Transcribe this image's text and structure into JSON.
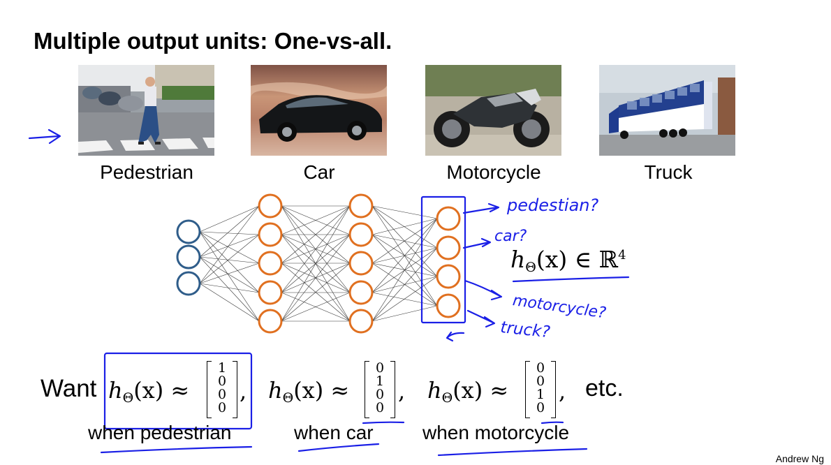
{
  "title": "Multiple output units: One-vs-all.",
  "images": [
    {
      "caption": "Pedestrian",
      "icon": "pedestrian-photo"
    },
    {
      "caption": "Car",
      "icon": "car-photo"
    },
    {
      "caption": "Motorcycle",
      "icon": "motorcycle-photo"
    },
    {
      "caption": "Truck",
      "icon": "truck-photo"
    }
  ],
  "network": {
    "layer_sizes": [
      3,
      5,
      5,
      4
    ],
    "input_color": "#2f5d8a",
    "hidden_color": "#e07020"
  },
  "hypothesis": {
    "h": "h",
    "theta": "Θ",
    "arg": "(x)",
    "rest": "∈ ℝ",
    "power": "4"
  },
  "handwritten": {
    "labels": [
      "pedestian?",
      "car?",
      "motorcycle?",
      "truck?"
    ],
    "ink_color": "#1a1fe6"
  },
  "bottom": {
    "want": "Want",
    "approx": "≈",
    "vectors": [
      [
        "1",
        "0",
        "0",
        "0"
      ],
      [
        "0",
        "1",
        "0",
        "0"
      ],
      [
        "0",
        "0",
        "1",
        "0"
      ]
    ],
    "comma": ",",
    "etc": "etc.",
    "whens": [
      "when pedestrian",
      "when car",
      "when motorcycle"
    ]
  },
  "author": "Andrew Ng"
}
